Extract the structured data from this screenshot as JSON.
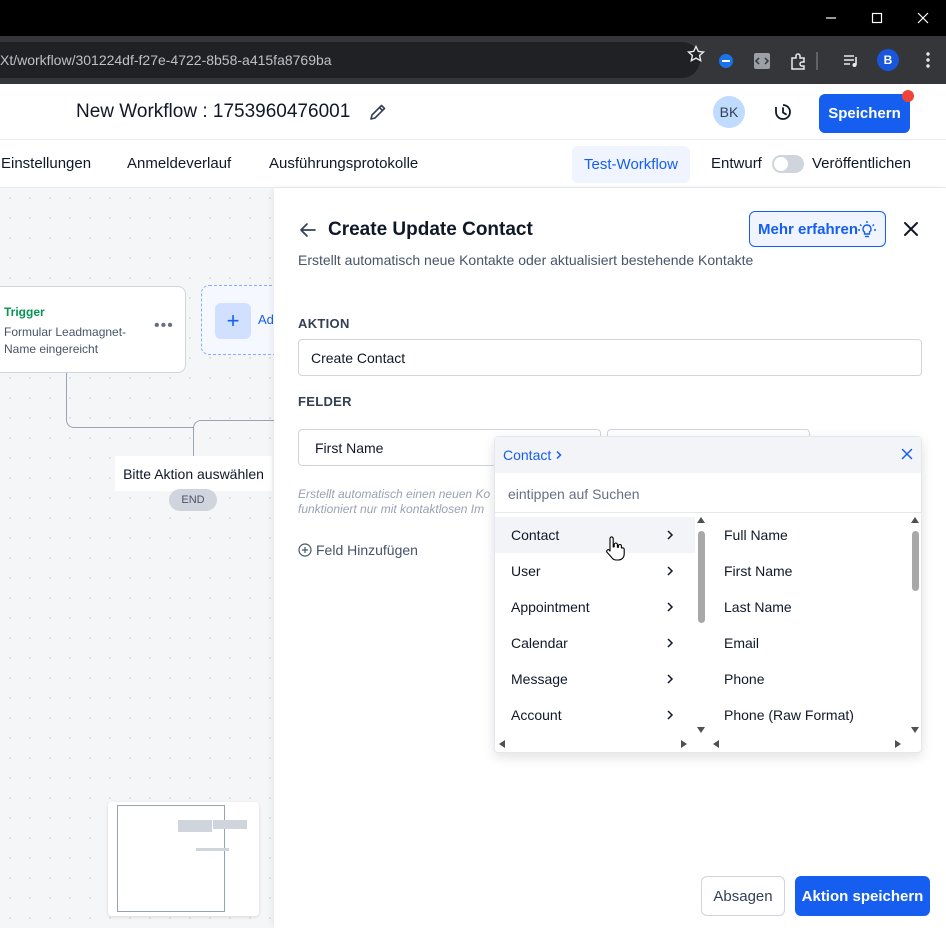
{
  "browser": {
    "url": "Xt/workflow/301224df-f27e-4722-8b58-a415fa8769ba",
    "profile_initial": "B"
  },
  "header": {
    "workflow_title": "New Workflow : 1753960476001",
    "user_initials": "BK",
    "save_label": "Speichern"
  },
  "tabs": {
    "items": [
      "Einstellungen",
      "Anmeldeverlauf",
      "Ausführungsprotokolle"
    ],
    "test_label": "Test-Workflow",
    "draft_label": "Entwurf",
    "publish_label": "Veröffentlichen"
  },
  "canvas": {
    "trigger_title": "Trigger",
    "trigger_desc": "Formular Leadmagnet-Name eingereicht",
    "add_label": "Ad",
    "action_placeholder": "Bitte Aktion auswählen",
    "end_label": "END"
  },
  "panel": {
    "title": "Create Update Contact",
    "subtitle": "Erstellt automatisch neue Kontakte oder aktualisiert bestehende Kontakte",
    "learn_more": "Mehr erfahren",
    "action_section": "AKTION",
    "action_value": "Create Contact",
    "fields_section": "FELDER",
    "field_name": "First Name",
    "help_line1": "Erstellt automatisch einen neuen Ko",
    "help_line2": "funktioniert nur mit kontaktlosen Im",
    "add_field": "Feld Hinzufügen",
    "cancel": "Absagen",
    "save_action": "Aktion speichern"
  },
  "dropdown": {
    "breadcrumb": "Contact",
    "search_placeholder": "eintippen auf Suchen",
    "categories": [
      "Contact",
      "User",
      "Appointment",
      "Calendar",
      "Message",
      "Account"
    ],
    "active_category": "Contact",
    "fields": [
      "Full Name",
      "First Name",
      "Last Name",
      "Email",
      "Phone",
      "Phone (Raw Format)"
    ]
  },
  "colors": {
    "accent": "#155eef",
    "trigger_green": "#079455",
    "notification_red": "#f04438"
  }
}
